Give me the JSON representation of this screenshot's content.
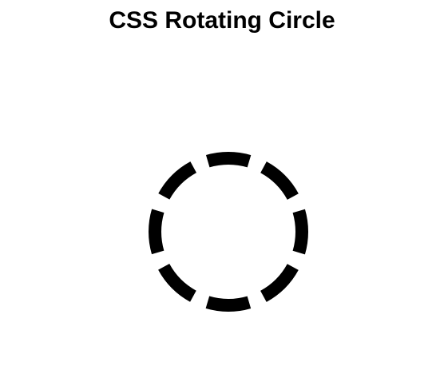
{
  "page": {
    "title": "CSS Rotating Circle"
  },
  "circle": {
    "color": "#000000",
    "segments": 8
  }
}
